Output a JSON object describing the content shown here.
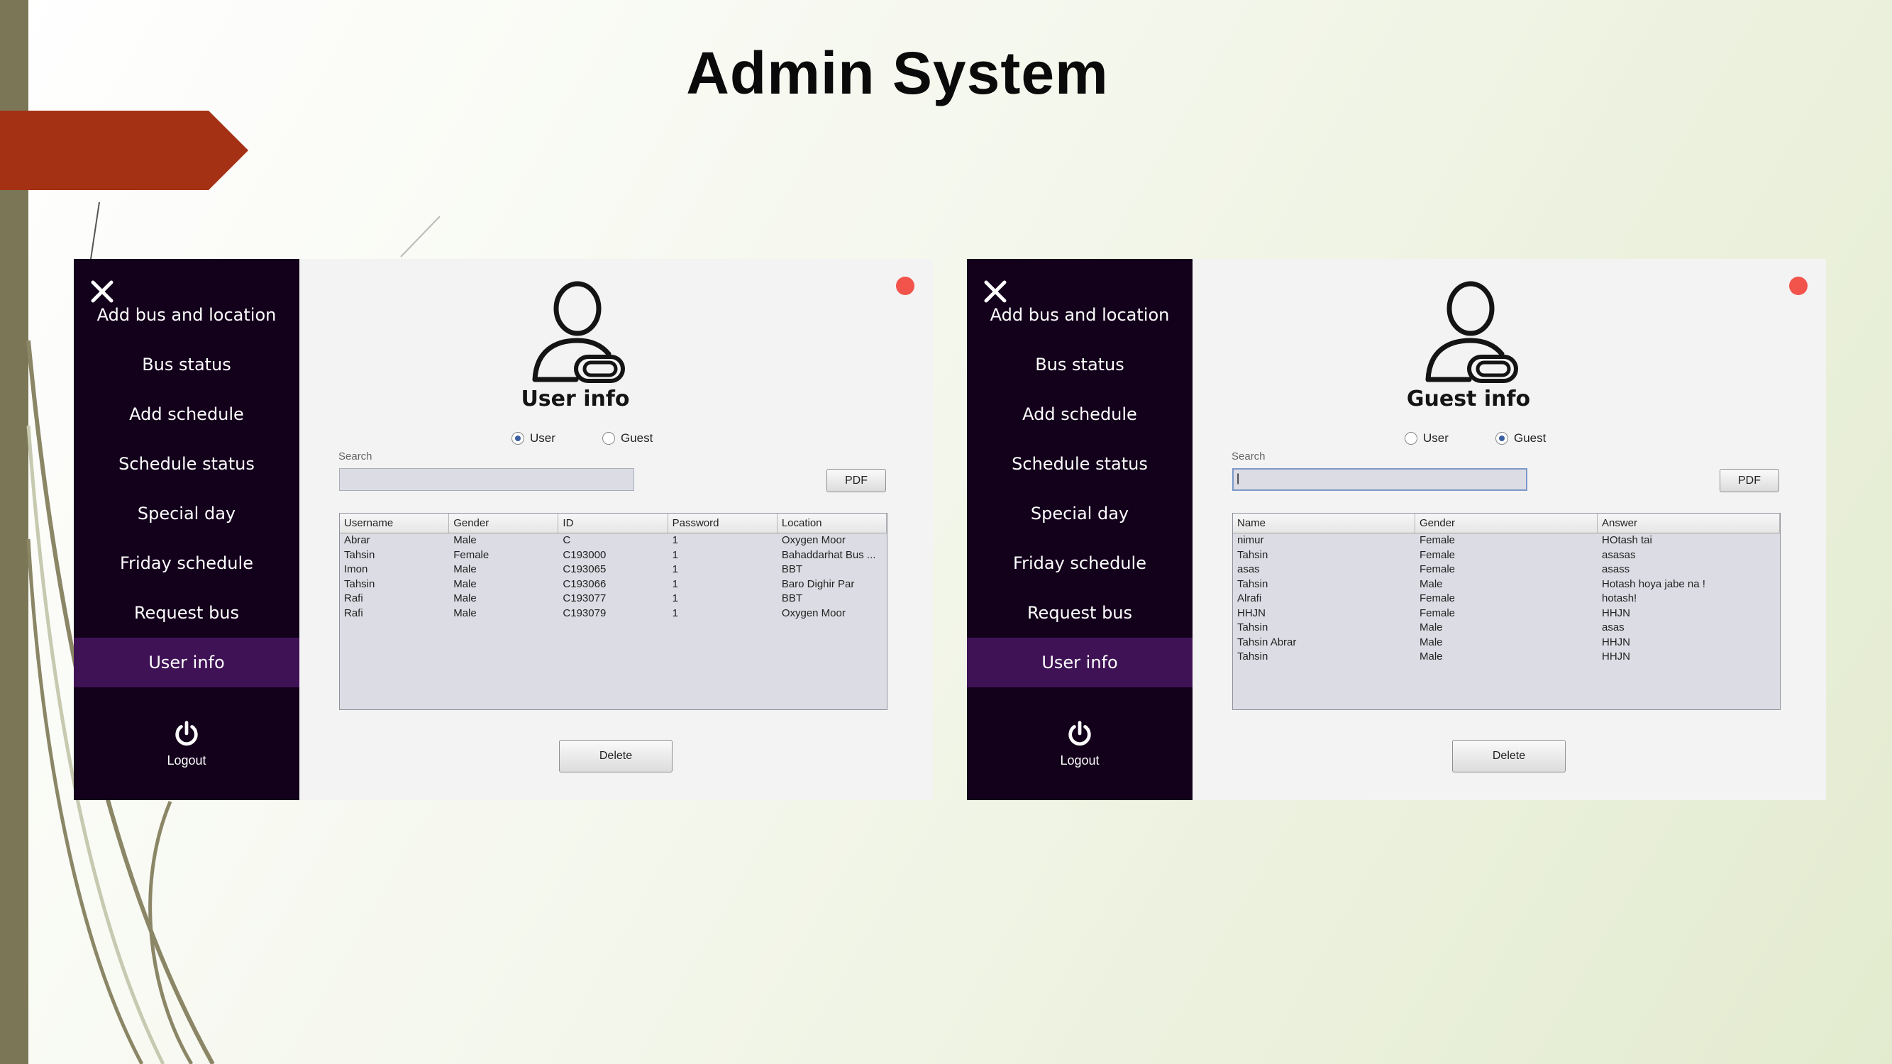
{
  "slide": {
    "title": "Admin System"
  },
  "sidebar": {
    "items": [
      {
        "label": "Add bus and location"
      },
      {
        "label": "Bus status"
      },
      {
        "label": "Add schedule"
      },
      {
        "label": "Schedule status"
      },
      {
        "label": "Special day"
      },
      {
        "label": "Friday schedule"
      },
      {
        "label": "Request bus"
      },
      {
        "label": "User info"
      }
    ],
    "active_item": "User info",
    "logout_label": "Logout"
  },
  "colors": {
    "sidebar_bg": "#13001b",
    "active_item_bg": "#3f1256",
    "close_dot": "#f2544b",
    "accent_arrow": "#a53115"
  },
  "panels": {
    "left": {
      "title": "User info",
      "radio_user": "User",
      "radio_guest": "Guest",
      "selected_radio": "User",
      "search_label": "Search",
      "search_value": "",
      "pdf_label": "PDF",
      "delete_label": "Delete",
      "columns": [
        "Username",
        "Gender",
        "ID",
        "Password",
        "Location"
      ],
      "rows": [
        [
          "Abrar",
          "Male",
          "C",
          "1",
          "Oxygen Moor"
        ],
        [
          "Tahsin",
          "Female",
          "C193000",
          "1",
          "Bahaddarhat Bus ..."
        ],
        [
          "Imon",
          "Male",
          "C193065",
          "1",
          "BBT"
        ],
        [
          "Tahsin",
          "Male",
          "C193066",
          "1",
          "Baro Dighir Par"
        ],
        [
          "Rafi",
          "Male",
          "C193077",
          "1",
          "BBT"
        ],
        [
          "Rafi",
          "Male",
          "C193079",
          "1",
          "Oxygen Moor"
        ]
      ]
    },
    "right": {
      "title": "Guest info",
      "radio_user": "User",
      "radio_guest": "Guest",
      "selected_radio": "Guest",
      "search_label": "Search",
      "search_value": "|",
      "pdf_label": "PDF",
      "delete_label": "Delete",
      "columns": [
        "Name",
        "Gender",
        "Answer"
      ],
      "rows": [
        [
          "nimur",
          "Female",
          "HOtash tai"
        ],
        [
          "Tahsin",
          "Female",
          "asasas"
        ],
        [
          "asas",
          "Female",
          "asass"
        ],
        [
          "Tahsin",
          "Male",
          "Hotash hoya jabe na !"
        ],
        [
          "Alrafi",
          "Female",
          "hotash!"
        ],
        [
          "HHJN",
          "Female",
          "HHJN"
        ],
        [
          "Tahsin",
          "Male",
          "asas"
        ],
        [
          "Tahsin Abrar",
          "Male",
          "HHJN"
        ],
        [
          "Tahsin",
          "Male",
          "HHJN"
        ]
      ]
    }
  }
}
